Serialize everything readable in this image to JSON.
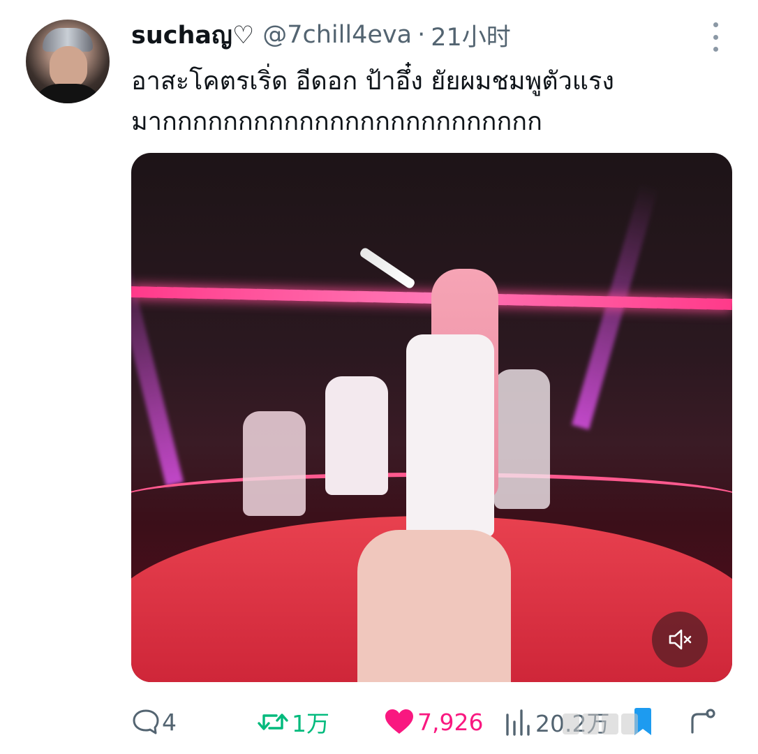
{
  "tweet": {
    "author_name": "suchaญ♡",
    "author_handle": "@7chill4eva",
    "separator": "·",
    "time": "21小时",
    "text_lines": [
      "อาสะโคตรเริ่ด อีดอก ป้าอึ๋ง ยัยผมชมพูตัวแรง",
      "มากกกกกกกกกกกกกกกกกกกกกกกกก"
    ]
  },
  "actions": {
    "replies": "4",
    "retweets": "1万",
    "likes": "7,926",
    "views": "20.2万"
  },
  "icons": {
    "more": "more-vertical-icon",
    "reply": "comment-bubble-icon",
    "retweet": "retweet-icon",
    "like": "heart-filled-icon",
    "views": "bar-chart-icon",
    "bookmark": "bookmark-icon",
    "share": "share-icon",
    "mute": "speaker-muted-icon"
  },
  "colors": {
    "text": "#0f1419",
    "secondary": "#536471",
    "retweet": "#00ba7c",
    "like": "#f91880",
    "bookmark": "#1d9bf0"
  }
}
